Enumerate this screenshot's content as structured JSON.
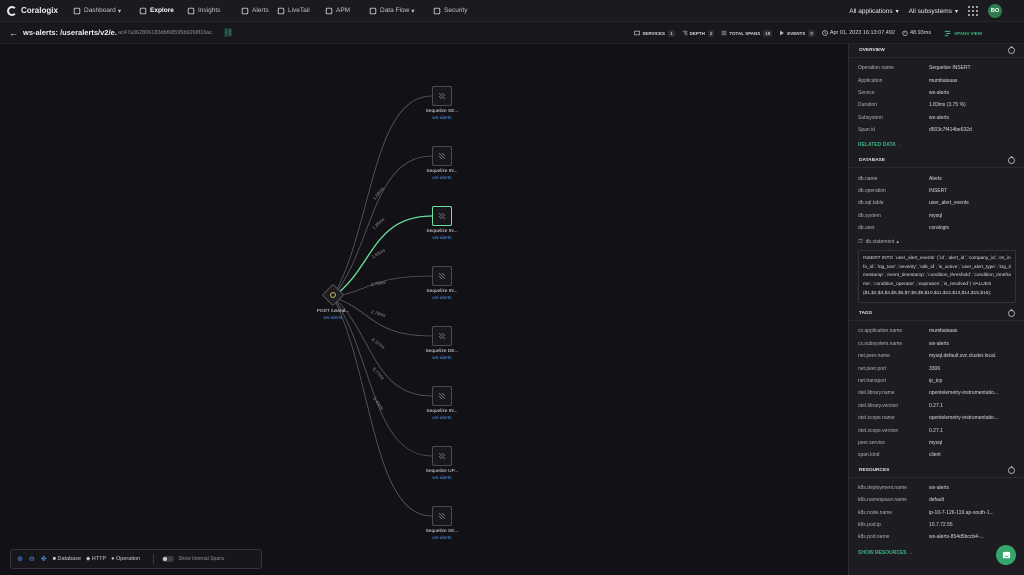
{
  "nav": {
    "brand": "Coralogix",
    "items": [
      {
        "label": "Dashboard",
        "chevron": "▾",
        "icon": "grid-icon",
        "active": false
      },
      {
        "label": "Explore",
        "icon": "compass-icon",
        "active": true
      },
      {
        "label": "Insights",
        "icon": "insights-icon",
        "active": false
      },
      {
        "label": "Alerts",
        "icon": "bell-icon",
        "active": false
      },
      {
        "label": "LiveTail",
        "icon": "livetail-icon",
        "active": false
      },
      {
        "label": "APM",
        "icon": "apm-icon",
        "active": false
      },
      {
        "label": "Data Flow",
        "chevron": "▾",
        "icon": "dataflow-icon",
        "active": false
      },
      {
        "label": "Security",
        "icon": "shield-icon",
        "active": false
      }
    ],
    "applications": "All applications",
    "subsystems": "All subsystems",
    "avatar": "BO"
  },
  "subheader": {
    "title": "ws-alerts: /useralerts/v2/e...",
    "trace_id": "ac47a362806183dbf08595b926f810ac",
    "stats": [
      {
        "label": "SERVICES",
        "count": "1"
      },
      {
        "label": "DEPTH",
        "count": "2"
      },
      {
        "label": "TOTAL SPANS",
        "count": "18"
      },
      {
        "label": "EVENTS",
        "count": "0"
      }
    ],
    "timestamp": "Apr 01, 2023 16:13:07.492",
    "duration": "48.93ms",
    "spans_view": "SPANS VIEW"
  },
  "graph": {
    "root": {
      "name": "POST /useral...",
      "service": "ws-alerts"
    },
    "children": [
      {
        "name": "Sequelize SE...",
        "service": "ws-alerts",
        "edge": "1.66ms",
        "selected": false
      },
      {
        "name": "Sequelize IN...",
        "service": "ws-alerts",
        "edge": "1.85ms",
        "selected": false
      },
      {
        "name": "Sequelize IN...",
        "service": "ws-alerts",
        "edge": "1.83ms",
        "selected": true
      },
      {
        "name": "Sequelize IN...",
        "service": "ws-alerts",
        "edge": "2.75ms",
        "selected": false
      },
      {
        "name": "Sequelize DE...",
        "service": "ws-alerts",
        "edge": "2.79ms",
        "selected": false
      },
      {
        "name": "Sequelize IN...",
        "service": "ws-alerts",
        "edge": "6.37ms",
        "selected": false
      },
      {
        "name": "Sequelize UP...",
        "service": "ws-alerts",
        "edge": "8.77ms",
        "selected": false
      },
      {
        "name": "Sequelize SE...",
        "service": "ws-alerts",
        "edge": "3.43ms",
        "selected": false
      }
    ],
    "colors": {
      "edge": "#5a5a62",
      "selected_edge": "#6de29e",
      "service": "#4f8ff0"
    }
  },
  "legend": {
    "items": [
      "Database",
      "HTTP",
      "Operation"
    ],
    "toggle_label": "Show Internal Spans"
  },
  "panel": {
    "overview": {
      "title": "OVERVIEW",
      "rows": [
        {
          "k": "Operation name",
          "v": "Sequelize INSERT"
        },
        {
          "k": "Application",
          "v": "mumbaisaas"
        },
        {
          "k": "Service",
          "v": "ws-alerts"
        },
        {
          "k": "Duration",
          "v": "1.83ms (3.75 %)"
        },
        {
          "k": "Subsystem",
          "v": "ws-alerts"
        },
        {
          "k": "Span id",
          "v": "d503c7f414be632d"
        }
      ],
      "related": "RELATED DATA"
    },
    "database": {
      "title": "DATABASE",
      "rows": [
        {
          "k": "db.name",
          "v": "Alerts"
        },
        {
          "k": "db.operation",
          "v": "INSERT"
        },
        {
          "k": "db.sql.table",
          "v": "user_alert_events"
        },
        {
          "k": "db.system",
          "v": "mysql"
        },
        {
          "k": "db.user",
          "v": "coralogix"
        }
      ],
      "statement_label": "db.statement",
      "statement": "INSERT INTO `user_alert_events` (`id`,`alert_id`,`company_id`,`es_info_id`,`log_text`,`severity`,`sdk_id`,`is_active`,`user_alert_type`,`log_timestamp`,`event_timestamp`,`condition_threshold`,`condition_timeframe`,`condition_operator`,`expiration`,`is_resolved`) VALUES ($1,$2,$3,$4,$5,$6,$7,$8,$9,$10,$11,$12,$13,$14,$15,$16);"
    },
    "tags": {
      "title": "TAGS",
      "rows": [
        {
          "k": "cx.application.name",
          "v": "mumbaisaas"
        },
        {
          "k": "cx.subsystem.name",
          "v": "ws-alerts"
        },
        {
          "k": "net.peer.name",
          "v": "mysql.default.svc.cluster.local."
        },
        {
          "k": "net.peer.port",
          "v": "3306"
        },
        {
          "k": "net.transport",
          "v": "ip_tcp"
        },
        {
          "k": "otel.library.name",
          "v": "opentelemetry-instrumentatio..."
        },
        {
          "k": "otel.library.version",
          "v": "0.27.1"
        },
        {
          "k": "otel.scope.name",
          "v": "opentelemetry-instrumentatio..."
        },
        {
          "k": "otel.scope.version",
          "v": "0.27.1"
        },
        {
          "k": "peer.service",
          "v": "mysql"
        },
        {
          "k": "span.kind",
          "v": "client"
        }
      ]
    },
    "resources": {
      "title": "RESOURCES",
      "rows": [
        {
          "k": "k8s.deployment.name",
          "v": "ws-alerts"
        },
        {
          "k": "k8s.namespace.name",
          "v": "default"
        },
        {
          "k": "k8s.node.name",
          "v": "ip-10-7-126-119.ap-south-1..."
        },
        {
          "k": "k8s.pod.ip",
          "v": "10.7.72.55"
        },
        {
          "k": "k8s.pod.name",
          "v": "ws-alerts-854d5bccb4-..."
        }
      ],
      "show": "SHOW RESOURCES"
    }
  }
}
